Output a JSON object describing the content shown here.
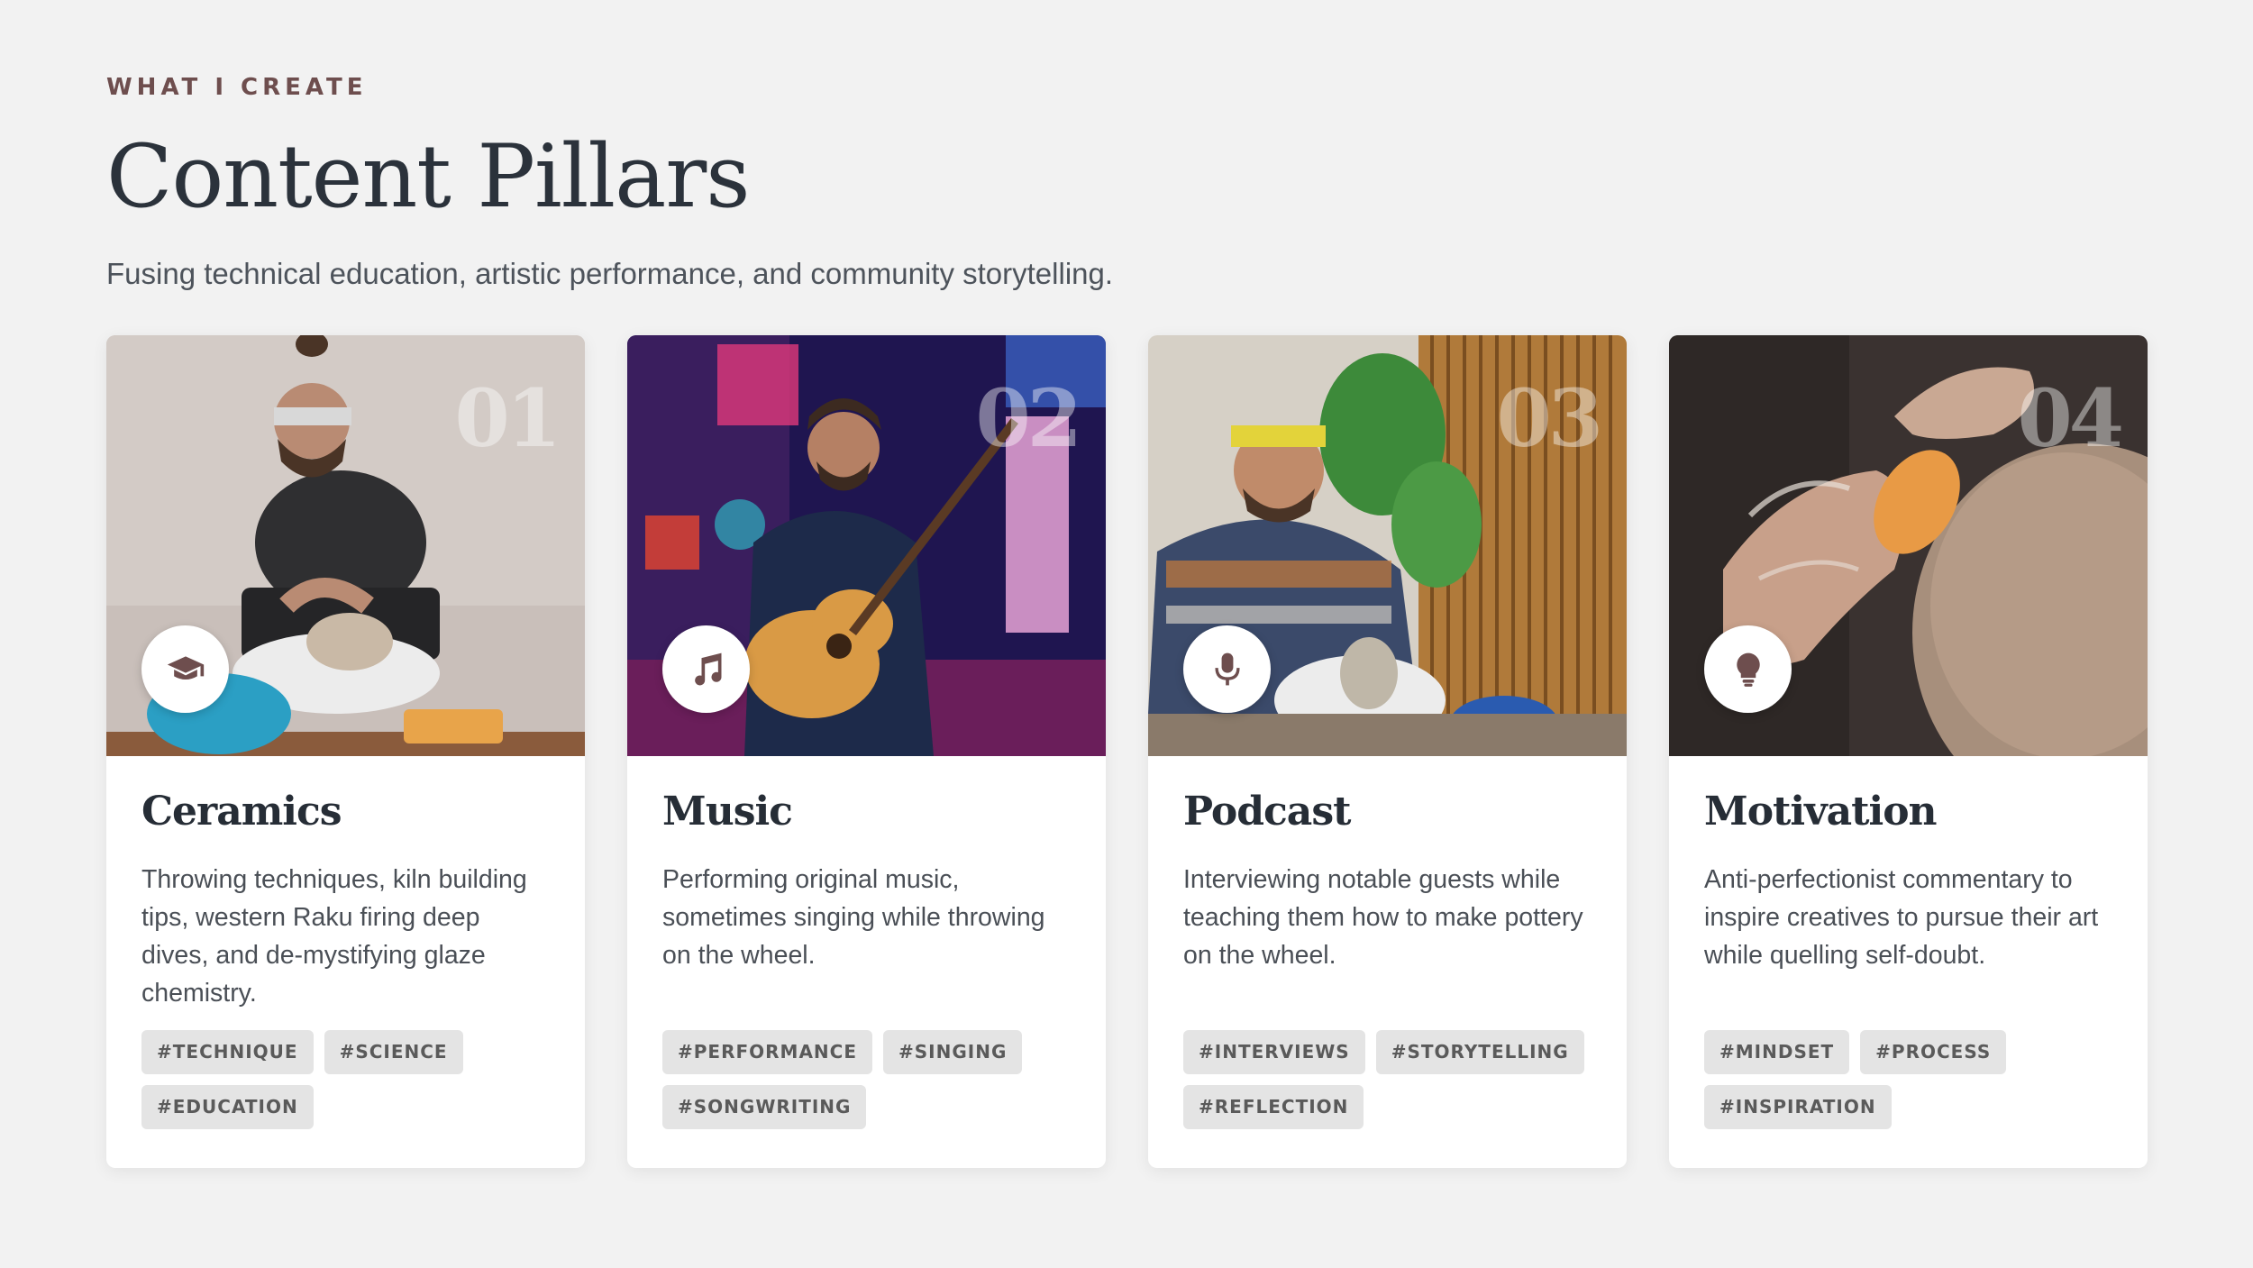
{
  "header": {
    "eyebrow": "WHAT I CREATE",
    "title": "Content Pillars",
    "subtitle": "Fusing technical education, artistic performance, and community storytelling."
  },
  "cards": [
    {
      "number": "01",
      "icon": "graduation-cap-icon",
      "title": "Ceramics",
      "description": "Throwing techniques, kiln building tips, western Raku firing deep dives, and de-mystifying glaze chemistry.",
      "tags": [
        "#TECHNIQUE",
        "#SCIENCE",
        "#EDUCATION"
      ]
    },
    {
      "number": "02",
      "icon": "music-note-icon",
      "title": "Music",
      "description": "Performing original music, sometimes singing while throwing on the wheel.",
      "tags": [
        "#PERFORMANCE",
        "#SINGING",
        "#SONGWRITING"
      ]
    },
    {
      "number": "03",
      "icon": "microphone-icon",
      "title": "Podcast",
      "description": "Interviewing notable guests while teaching them how to make pottery on the wheel.",
      "tags": [
        "#INTERVIEWS",
        "#STORYTELLING",
        "#REFLECTION"
      ]
    },
    {
      "number": "04",
      "icon": "lightbulb-icon",
      "title": "Motivation",
      "description": "Anti-perfectionist commentary to inspire creatives to pursue their art while quelling self-doubt.",
      "tags": [
        "#MINDSET",
        "#PROCESS",
        "#INSPIRATION"
      ]
    }
  ],
  "colors": {
    "background": "#f2f2f2",
    "eyebrow": "#6e4e4e",
    "title": "#2b323b",
    "icon": "#6e4e4e",
    "tag_bg": "#e4e4e4"
  }
}
